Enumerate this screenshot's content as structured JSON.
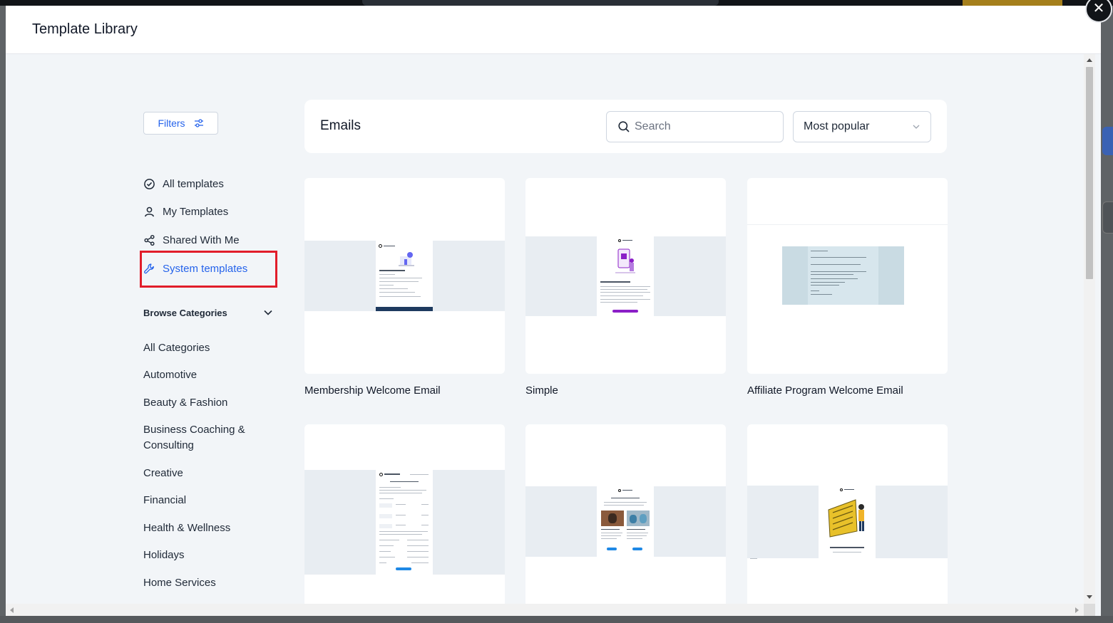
{
  "modal": {
    "title": "Template Library",
    "close_symbol": "✕"
  },
  "sidebar": {
    "filters_label": "Filters",
    "nav": [
      {
        "label": "All templates",
        "icon": "check-circle-icon",
        "active": false
      },
      {
        "label": "My Templates",
        "icon": "user-icon",
        "active": false
      },
      {
        "label": "Shared With Me",
        "icon": "share-icon",
        "active": false
      },
      {
        "label": "System templates",
        "icon": "wrench-icon",
        "active": true
      }
    ],
    "browse_categories_label": "Browse Categories",
    "categories": [
      "All Categories",
      "Automotive",
      "Beauty & Fashion",
      "Business Coaching & Consulting",
      "Creative",
      "Financial",
      "Health & Wellness",
      "Holidays",
      "Home Services"
    ]
  },
  "main": {
    "section_title": "Emails",
    "search": {
      "placeholder": "Search",
      "value": ""
    },
    "sort": {
      "selected": "Most popular"
    },
    "templates": [
      {
        "name": "Membership Welcome Email"
      },
      {
        "name": "Simple"
      },
      {
        "name": "Affiliate Program Welcome Email"
      },
      {
        "name": ""
      },
      {
        "name": ""
      },
      {
        "name": ""
      }
    ]
  },
  "colors": {
    "accent": "#2563eb",
    "highlight": "#e11d2a",
    "purple_cta": "#8b1fc7",
    "blue_cta": "#1e88e5"
  }
}
